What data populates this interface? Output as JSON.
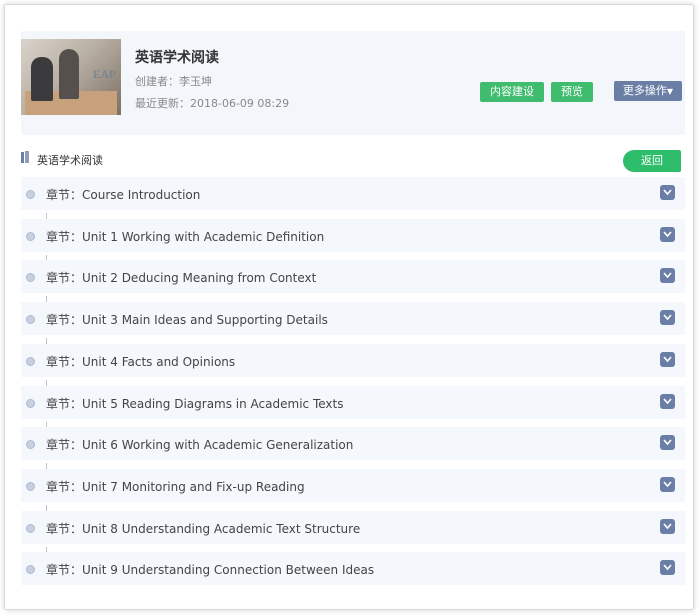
{
  "course": {
    "title": "英语学术阅读",
    "creator": "创建者：李玉坤",
    "updated": "最近更新：2018-06-09 08:29",
    "thumb_text": "EAP"
  },
  "actions": {
    "content_build": "内容建设",
    "preview": "预览",
    "more": "更多操作"
  },
  "section": {
    "title": "英语学术阅读",
    "back": "返回"
  },
  "chapters": [
    {
      "label": "章节：Course Introduction"
    },
    {
      "label": "章节：Unit 1 Working with Academic Definition"
    },
    {
      "label": "章节：Unit 2 Deducing Meaning from Context"
    },
    {
      "label": "章节：Unit 3 Main Ideas and Supporting Details"
    },
    {
      "label": "章节：Unit 4 Facts and Opinions"
    },
    {
      "label": "章节：Unit 5 Reading Diagrams in Academic Texts"
    },
    {
      "label": "章节：Unit 6 Working with Academic Generalization"
    },
    {
      "label": "章节：Unit 7 Monitoring and Fix-up Reading"
    },
    {
      "label": "章节：Unit 8 Understanding Academic Text Structure"
    },
    {
      "label": "章节：Unit 9 Understanding Connection Between Ideas"
    }
  ],
  "colors": {
    "green": "#3fbc6e",
    "slate": "#6b7fa6",
    "row_bg": "#f4f8fc"
  }
}
